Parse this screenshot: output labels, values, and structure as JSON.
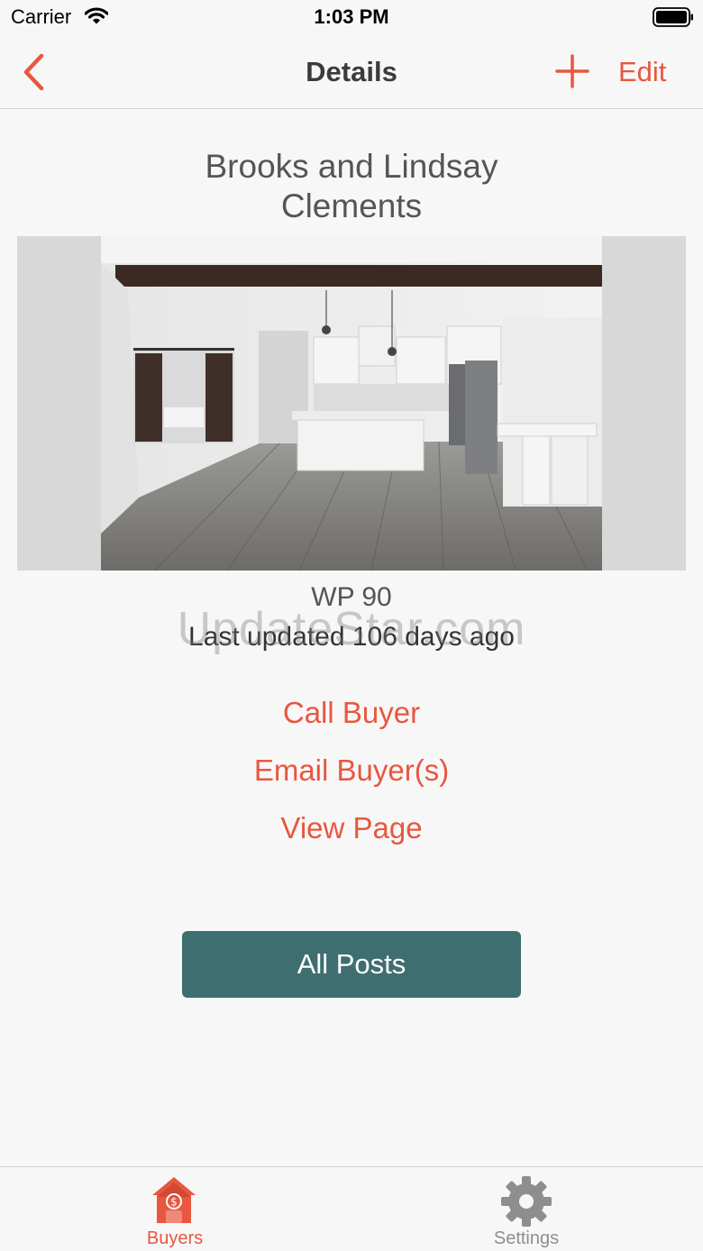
{
  "status_bar": {
    "carrier": "Carrier",
    "time": "1:03 PM"
  },
  "nav": {
    "title": "Details",
    "edit_label": "Edit",
    "back_icon": "chevron-left-icon",
    "add_icon": "plus-icon"
  },
  "buyer": {
    "name_line1": "Brooks and Lindsay",
    "name_line2": "Clements"
  },
  "post": {
    "title": "WP 90",
    "last_updated": "Last updated 106 days ago"
  },
  "watermark": "UpdateStar.com",
  "actions": {
    "call": "Call Buyer",
    "email": "Email Buyer(s)",
    "view": "View Page",
    "all_posts": "All Posts"
  },
  "tabs": [
    {
      "label": "Buyers",
      "icon": "house-dollar-icon",
      "selected": true
    },
    {
      "label": "Settings",
      "icon": "gear-icon",
      "selected": false
    }
  ],
  "colors": {
    "accent": "#e8573f",
    "button_bg": "#3f6e70",
    "inactive": "#8e8e8e"
  }
}
